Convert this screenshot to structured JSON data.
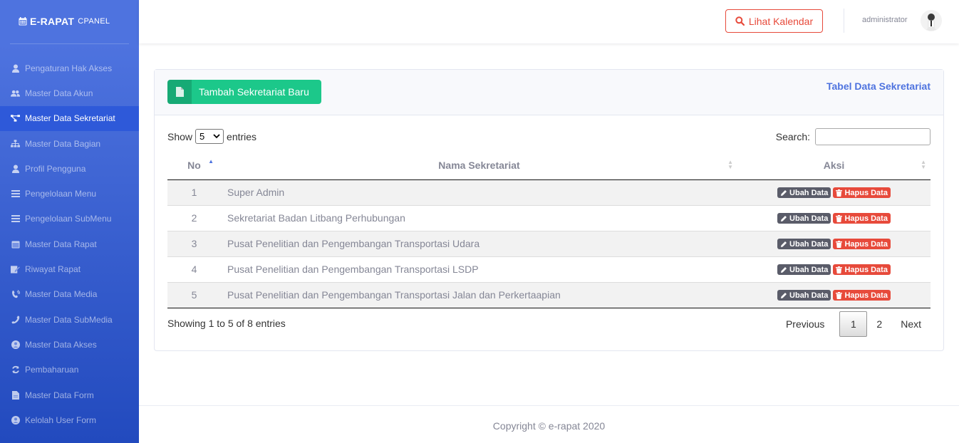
{
  "brand": {
    "title": "E-RAPAT",
    "subtitle": "CPANEL"
  },
  "sidebar": {
    "items": [
      {
        "label": "Pengaturan Hak Akses",
        "icon": "user-icon"
      },
      {
        "label": "Master Data Akun",
        "icon": "users-icon"
      },
      {
        "label": "Master Data Sekretariat",
        "icon": "project-diagram-icon",
        "active": true
      },
      {
        "label": "Master Data Bagian",
        "icon": "sitemap-icon"
      },
      {
        "label": "Profil Pengguna",
        "icon": "user-icon"
      },
      {
        "label": "Pengelolaan Menu",
        "icon": "bars-icon"
      },
      {
        "label": "Pengelolaan SubMenu",
        "icon": "bars-icon"
      },
      {
        "label": "Master Data Rapat",
        "icon": "calendar-icon"
      },
      {
        "label": "Riwayat Rapat",
        "icon": "edit-icon"
      },
      {
        "label": "Master Data Media",
        "icon": "phone-volume-icon"
      },
      {
        "label": "Master Data SubMedia",
        "icon": "phone-icon"
      },
      {
        "label": "Master Data Akses",
        "icon": "user-circle-icon"
      },
      {
        "label": "Pembaharuan",
        "icon": "sync-icon"
      },
      {
        "label": "Master Data Form",
        "icon": "file-icon"
      },
      {
        "label": "Kelolah User Form",
        "icon": "user-circle-icon"
      }
    ]
  },
  "topbar": {
    "calendar_button": "Lihat Kalendar",
    "username": "administrator"
  },
  "card": {
    "add_button": "Tambah Sekretariat Baru",
    "title": "Tabel Data Sekretariat"
  },
  "datatable": {
    "show_label": "Show",
    "entries_label": "entries",
    "page_length": "5",
    "search_label": "Search:",
    "search_value": "",
    "columns": [
      "No",
      "Nama Sekretariat",
      "Aksi"
    ],
    "edit_label": "Ubah Data",
    "delete_label": "Hapus Data",
    "rows": [
      {
        "no": "1",
        "nama": "Super Admin"
      },
      {
        "no": "2",
        "nama": "Sekretariat Badan Litbang Perhubungan"
      },
      {
        "no": "3",
        "nama": "Pusat Penelitian dan Pengembangan Transportasi Udara"
      },
      {
        "no": "4",
        "nama": "Pusat Penelitian dan Pengembangan Transportasi LSDP"
      },
      {
        "no": "5",
        "nama": "Pusat Penelitian dan Pengembangan Transportasi Jalan dan Perkertaapian"
      }
    ],
    "info": "Showing 1 to 5 of 8 entries",
    "pagination": {
      "previous": "Previous",
      "pages": [
        "1",
        "2"
      ],
      "current": "1",
      "next": "Next"
    }
  },
  "footer": {
    "copyright": "Copyright © e-rapat 2020"
  },
  "colors": {
    "primary": "#4e73df",
    "success": "#1cc88a",
    "danger": "#e74a3b",
    "dark": "#5a5c69"
  }
}
